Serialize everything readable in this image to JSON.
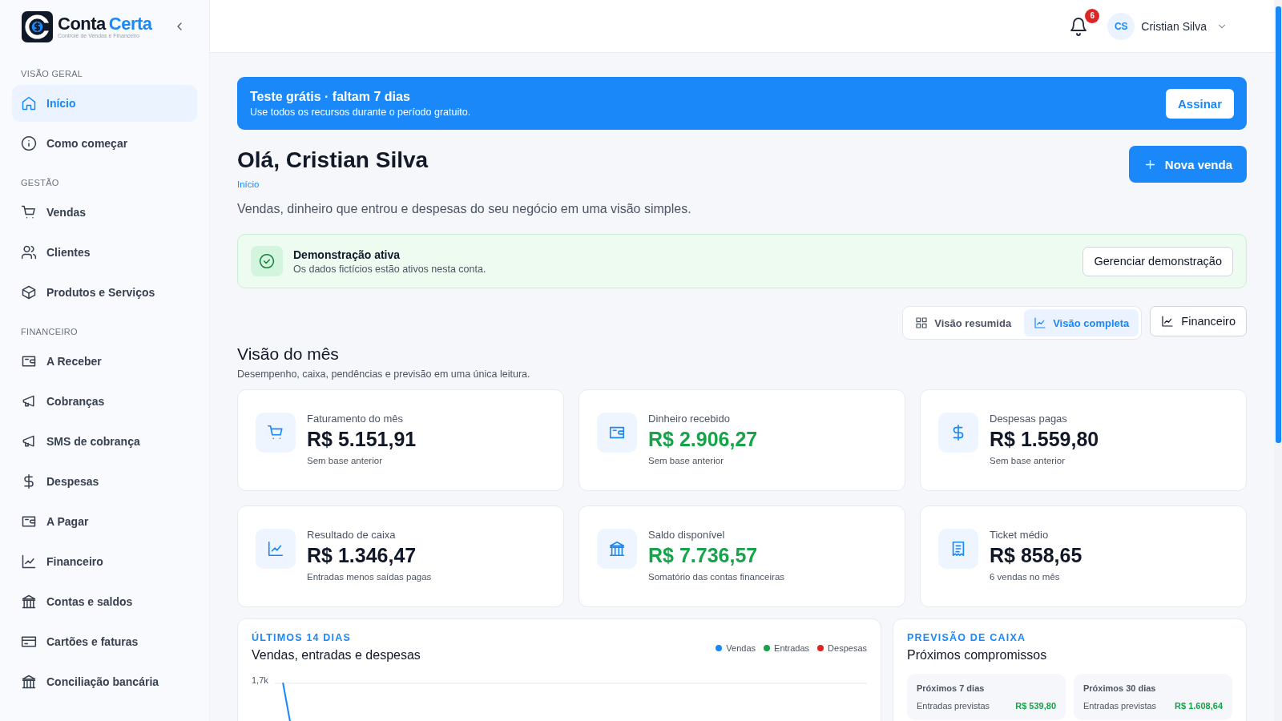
{
  "brand": {
    "name_first": "Conta",
    "name_second": "Certa",
    "tagline": "Controle de Vendas e Financeiro"
  },
  "sidebar": {
    "sections": [
      {
        "title": "VISÃO GERAL",
        "items": [
          {
            "label": "Início",
            "selected": true
          },
          {
            "label": "Como começar",
            "selected": false
          }
        ]
      },
      {
        "title": "GESTÃO",
        "items": [
          {
            "label": "Vendas",
            "selected": false
          },
          {
            "label": "Clientes",
            "selected": false
          },
          {
            "label": "Produtos e Serviços",
            "selected": false
          }
        ]
      },
      {
        "title": "FINANCEIRO",
        "items": [
          {
            "label": "A Receber",
            "selected": false
          },
          {
            "label": "Cobranças",
            "selected": false
          },
          {
            "label": "SMS de cobrança",
            "selected": false
          },
          {
            "label": "Despesas",
            "selected": false
          },
          {
            "label": "A Pagar",
            "selected": false
          },
          {
            "label": "Financeiro",
            "selected": false
          },
          {
            "label": "Contas e saldos",
            "selected": false
          },
          {
            "label": "Cartões e faturas",
            "selected": false
          },
          {
            "label": "Conciliação bancária",
            "selected": false
          }
        ]
      }
    ]
  },
  "header": {
    "notification_count": "6",
    "user": {
      "initials": "CS",
      "name": "Cristian Silva"
    }
  },
  "trial_banner": {
    "title": "Teste grátis · faltam 7 dias",
    "text": "Use todos os recursos durante o período gratuito.",
    "button": "Assinar"
  },
  "greeting": {
    "title": "Olá, Cristian Silva",
    "breadcrumb": "Início",
    "subtitle": "Vendas, dinheiro que entrou e despesas do seu negócio em uma visão simples.",
    "button": "Nova venda"
  },
  "demo_notice": {
    "title": "Demonstração ativa",
    "text": "Os dados fictícios estão ativos nesta conta.",
    "button": "Gerenciar demonstração"
  },
  "view_tabs": [
    {
      "label": "Visão resumida",
      "selected": false
    },
    {
      "label": "Visão completa",
      "selected": true
    }
  ],
  "financeiro_button": "Financeiro",
  "month_section": {
    "title": "Visão do mês",
    "subtitle": "Desempenho, caixa, pendências e previsão em uma única leitura."
  },
  "cards": [
    {
      "label": "Faturamento do mês",
      "value": "R$ 5.151,91",
      "note": "Sem base anterior",
      "positive": false
    },
    {
      "label": "Dinheiro recebido",
      "value": "R$ 2.906,27",
      "note": "Sem base anterior",
      "positive": true
    },
    {
      "label": "Despesas pagas",
      "value": "R$ 1.559,80",
      "note": "Sem base anterior",
      "positive": false
    },
    {
      "label": "Resultado de caixa",
      "value": "R$ 1.346,47",
      "note": "Entradas menos saídas pagas",
      "positive": false
    },
    {
      "label": "Saldo disponível",
      "value": "R$ 7.736,57",
      "note": "Somatório das contas financeiras",
      "positive": true
    },
    {
      "label": "Ticket médio",
      "value": "R$ 858,65",
      "note": "6 vendas no mês",
      "positive": false
    }
  ],
  "trend_panel": {
    "eyebrow": "ÚLTIMOS 14 DIAS",
    "title": "Vendas, entradas e despesas",
    "legend": [
      {
        "label": "Vendas",
        "color": "#1a88f8"
      },
      {
        "label": "Entradas",
        "color": "#16a34a"
      },
      {
        "label": "Despesas",
        "color": "#dc2626"
      }
    ],
    "axis_label": "1,7k"
  },
  "forecast_panel": {
    "eyebrow": "PREVISÃO DE CAIXA",
    "title": "Próximos compromissos",
    "periods": [
      {
        "title": "Próximos 7 dias",
        "label": "Entradas previstas",
        "value": "R$ 539,80"
      },
      {
        "title": "Próximos 30 dias",
        "label": "Entradas previstas",
        "value": "R$ 1.608,64"
      }
    ]
  }
}
